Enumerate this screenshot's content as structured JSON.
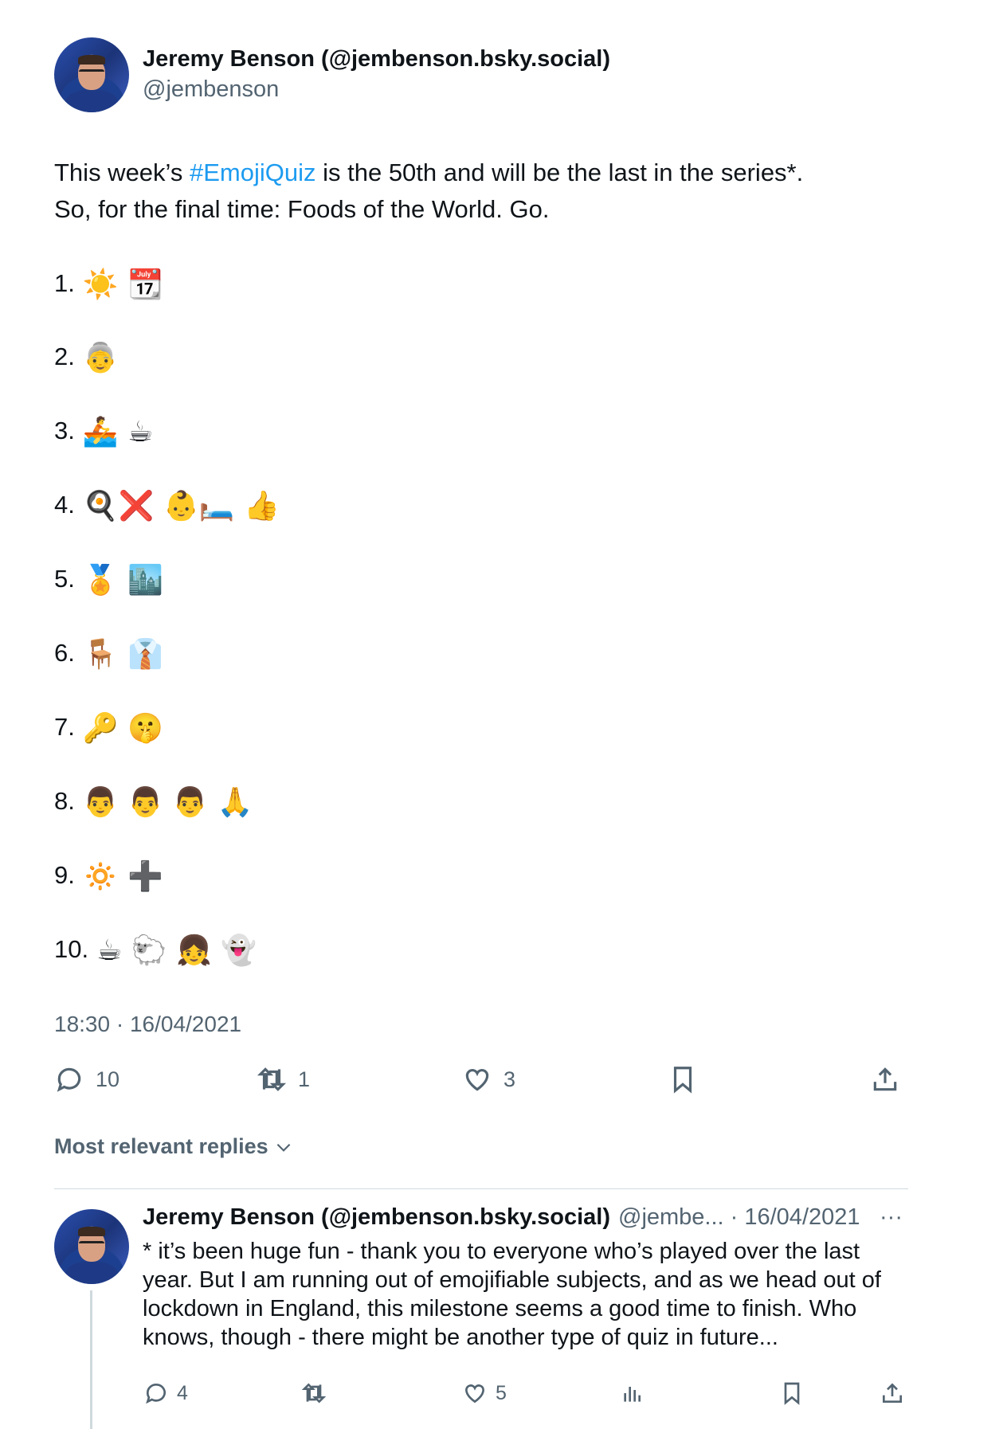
{
  "tweet": {
    "author_name": "Jeremy Benson (@jembenson.bsky.social)",
    "author_handle": "@jembenson",
    "text_before": "This week’s ",
    "hashtag": "#EmojiQuiz",
    "text_after": " is the 50th and will be the last in the series*.",
    "line2": "So, for the final time: Foods of the World. Go.",
    "items": [
      {
        "num": "1.",
        "emojis": "☀️ 📆"
      },
      {
        "num": "2.",
        "emojis": "👵"
      },
      {
        "num": "3.",
        "emojis": "🚣 ☕"
      },
      {
        "num": "4.",
        "emojis": "🍳❌ 👶🛏️ 👍"
      },
      {
        "num": "5.",
        "emojis": "🏅 🏙️"
      },
      {
        "num": "6.",
        "emojis": "🪑 👔"
      },
      {
        "num": "7.",
        "emojis": "🔑 🤫"
      },
      {
        "num": "8.",
        "emojis": "👨 👨 👨 🙏"
      },
      {
        "num": "9.",
        "emojis": "🔅 ➕"
      },
      {
        "num": "10.",
        "emojis": "☕ 🐑 👧 👻"
      }
    ],
    "timestamp": "18:30 · 16/04/2021",
    "reply_count": "10",
    "retweet_count": "1",
    "like_count": "3"
  },
  "replies_filter": "Most relevant replies",
  "reply": {
    "author_name": "Jeremy Benson (@jembenson.bsky.social)",
    "author_handle_date": "@jembe... · 16/04/2021",
    "more": "···",
    "text": "* it’s been huge fun - thank you to everyone who’s played over the last year. But I am running out of emojifiable subjects, and as we head out of lockdown in England, this milestone seems a good time to finish. Who knows, though - there might be another type of quiz in future...",
    "reply_count": "4",
    "like_count": "5"
  },
  "icons": {
    "reply": "speech-bubble-icon",
    "retweet": "retweet-icon",
    "like": "heart-icon",
    "bookmark": "bookmark-icon",
    "share": "share-icon",
    "views": "bar-chart-icon",
    "chevron": "chevron-down-icon"
  },
  "colors": {
    "hashtag": "#1d9bf0",
    "secondary": "#536471",
    "divider": "#cfd9de"
  }
}
